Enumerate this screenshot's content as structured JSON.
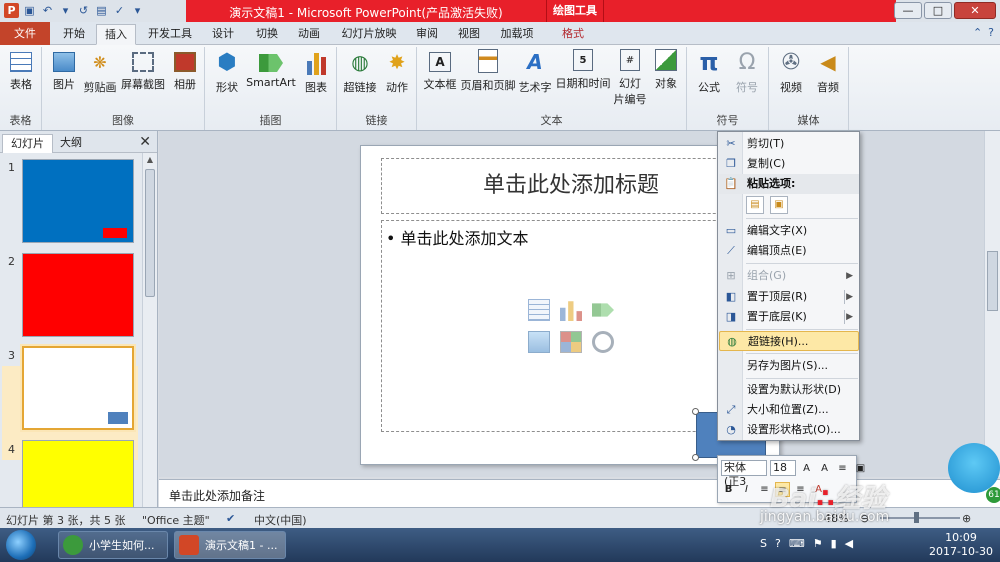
{
  "window": {
    "title": "演示文稿1 - Microsoft PowerPoint(产品激活失败)",
    "context_tab_group": "绘图工具"
  },
  "tabs": [
    "文件",
    "开始",
    "插入",
    "开发工具",
    "设计",
    "切换",
    "动画",
    "幻灯片放映",
    "审阅",
    "视图",
    "加载项",
    "格式"
  ],
  "active_tab": "插入",
  "ribbon": {
    "groups": {
      "tables": "表格",
      "images": "图像",
      "illustrations": "插图",
      "links": "链接",
      "text": "文本",
      "symbols": "符号",
      "media": "媒体"
    },
    "buttons": {
      "table": "表格",
      "picture": "图片",
      "clipart": "剪贴画",
      "screenshot": "屏幕截图",
      "album": "相册",
      "shapes": "形状",
      "smartart": "SmartArt",
      "chart": "图表",
      "hyperlink": "超链接",
      "action": "动作",
      "textbox": "文本框",
      "header_footer": "页眉和页脚",
      "wordart": "艺术字",
      "datetime": "日期和时间",
      "slide_number_line1": "幻灯",
      "slide_number_line2": "片编号",
      "object": "对象",
      "equation": "公式",
      "symbol": "符号",
      "video": "视频",
      "audio": "音频"
    }
  },
  "left_pane": {
    "tab_slides": "幻灯片",
    "tab_outline": "大纲",
    "slides": [
      {
        "num": "1",
        "color": "#0070c0"
      },
      {
        "num": "2",
        "color": "#ff0000"
      },
      {
        "num": "3",
        "color": "#ffffff"
      },
      {
        "num": "4",
        "color": "#ffff00"
      }
    ],
    "selected_slide": 3
  },
  "slide": {
    "title_placeholder": "单击此处添加标题",
    "body_placeholder": "单击此处添加文本",
    "bullet": "•"
  },
  "notes_placeholder": "单击此处添加备注",
  "context_menu": {
    "items": [
      {
        "label": "剪切(T)",
        "icon": "scissors-icon"
      },
      {
        "label": "复制(C)",
        "icon": "copy-icon"
      },
      {
        "label": "粘贴选项:",
        "icon": "paste-icon"
      },
      {
        "label": "编辑文字(X)",
        "icon": "edit-text-icon"
      },
      {
        "label": "编辑顶点(E)",
        "icon": "edit-points-icon"
      },
      {
        "label": "组合(G)",
        "icon": "group-icon"
      },
      {
        "label": "置于顶层(R)",
        "icon": "bring-front-icon"
      },
      {
        "label": "置于底层(K)",
        "icon": "send-back-icon"
      },
      {
        "label": "超链接(H)...",
        "icon": "hyperlink-icon"
      },
      {
        "label": "另存为图片(S)...",
        "icon": ""
      },
      {
        "label": "设置为默认形状(D)",
        "icon": ""
      },
      {
        "label": "大小和位置(Z)...",
        "icon": "size-icon"
      },
      {
        "label": "设置形状格式(O)...",
        "icon": "format-shape-icon"
      }
    ],
    "highlighted": "超链接(H)..."
  },
  "mini_toolbar": {
    "font": "宋体 (正3",
    "size": "18"
  },
  "status_bar": {
    "slide_info": "幻灯片 第 3 张，共 5 张",
    "theme": "\"Office 主题\"",
    "language": "中文(中国)",
    "zoom": "48%"
  },
  "taskbar": {
    "items": [
      "小学生如何...",
      "演示文稿1 - ..."
    ],
    "time": "10:09",
    "date": "2017-10-30"
  },
  "watermark": {
    "line1": "Bai",
    "line2": "jingyan.baidu.com",
    "brand_cn": "经验",
    "badge": "61"
  },
  "colors": {
    "title_bar_red": "#e8202a",
    "file_tab": "#c3442a",
    "selected_shape": "#4f81bd",
    "menu_highlight": "#fde8a6"
  }
}
